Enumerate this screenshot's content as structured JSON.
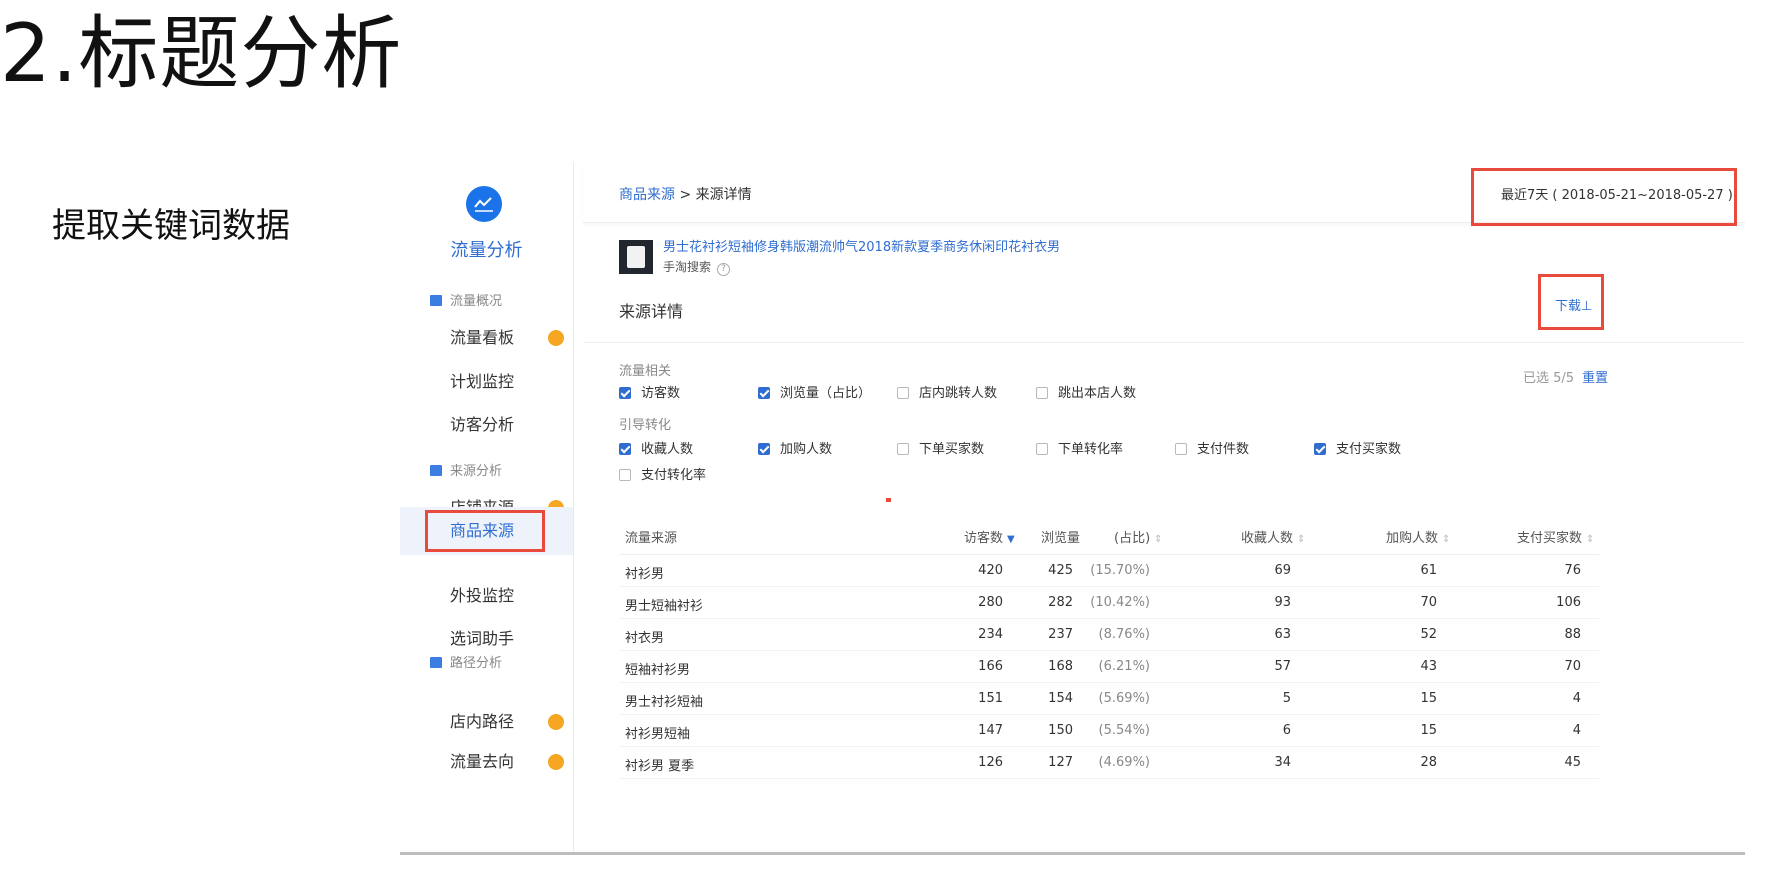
{
  "slide": {
    "title": "2.标题分析",
    "subtitle": "提取关键词数据"
  },
  "sidebar": {
    "logo_icon": "line-chart-icon",
    "title": "流量分析",
    "groups": [
      {
        "label": "流量概况",
        "items": [
          {
            "label": "流量看板",
            "dot": true
          },
          {
            "label": "计划监控"
          },
          {
            "label": "访客分析"
          }
        ]
      },
      {
        "label": "来源分析",
        "items": [
          {
            "label": "店铺来源",
            "dot": true
          },
          {
            "label": "商品来源",
            "active": true
          },
          {
            "label": "外投监控"
          },
          {
            "label": "选词助手"
          }
        ]
      },
      {
        "label": "路径分析",
        "items": [
          {
            "label": "店内路径",
            "dot": true
          },
          {
            "label": "流量去向",
            "dot": true
          }
        ]
      }
    ]
  },
  "breadcrumb": {
    "parent": "商品来源",
    "separator": " > ",
    "current": "来源详情"
  },
  "date_range": "最近7天 ( 2018-05-21~2018-05-27 )",
  "product": {
    "title": "男士花衬衫短袖修身韩版潮流帅气2018新款夏季商务休闲印花衬衣男",
    "source": "手淘搜索",
    "help": "?"
  },
  "section": {
    "title": "来源详情",
    "download": "下载⊥"
  },
  "filters": {
    "selected_label": "已选 5/5",
    "reset_label": "重置",
    "group1": {
      "label": "流量相关",
      "options": [
        {
          "label": "访客数",
          "checked": true
        },
        {
          "label": "浏览量（占比）",
          "checked": true
        },
        {
          "label": "店内跳转人数",
          "checked": false
        },
        {
          "label": "跳出本店人数",
          "checked": false
        }
      ]
    },
    "group2": {
      "label": "引导转化",
      "options": [
        {
          "label": "收藏人数",
          "checked": true
        },
        {
          "label": "加购人数",
          "checked": true
        },
        {
          "label": "下单买家数",
          "checked": false
        },
        {
          "label": "下单转化率",
          "checked": false
        },
        {
          "label": "支付件数",
          "checked": false
        },
        {
          "label": "支付买家数",
          "checked": true
        },
        {
          "label": "支付转化率",
          "checked": false
        }
      ]
    }
  },
  "table": {
    "headers": {
      "source": "流量来源",
      "visitors": "访客数",
      "views": "浏览量",
      "share": "(占比)",
      "favorites": "收藏人数",
      "cart": "加购人数",
      "buyers": "支付买家数"
    },
    "rows": [
      {
        "source": "衬衫男",
        "visitors": "420",
        "views": "425",
        "share": "(15.70%)",
        "favorites": "69",
        "cart": "61",
        "buyers": "76"
      },
      {
        "source": "男士短袖衬衫",
        "visitors": "280",
        "views": "282",
        "share": "(10.42%)",
        "favorites": "93",
        "cart": "70",
        "buyers": "106"
      },
      {
        "source": "衬衣男",
        "visitors": "234",
        "views": "237",
        "share": "(8.76%)",
        "favorites": "63",
        "cart": "52",
        "buyers": "88"
      },
      {
        "source": "短袖衬衫男",
        "visitors": "166",
        "views": "168",
        "share": "(6.21%)",
        "favorites": "57",
        "cart": "43",
        "buyers": "70"
      },
      {
        "source": "男士衬衫短袖",
        "visitors": "151",
        "views": "154",
        "share": "(5.69%)",
        "favorites": "5",
        "cart": "15",
        "buyers": "4"
      },
      {
        "source": "衬衫男短袖",
        "visitors": "147",
        "views": "150",
        "share": "(5.54%)",
        "favorites": "6",
        "cart": "15",
        "buyers": "4"
      },
      {
        "source": "衬衫男 夏季",
        "visitors": "126",
        "views": "127",
        "share": "(4.69%)",
        "favorites": "34",
        "cart": "28",
        "buyers": "45"
      }
    ]
  },
  "colors": {
    "accent": "#2f6dd0",
    "highlight_box": "#e84a3c",
    "badge": "#f5a623"
  }
}
